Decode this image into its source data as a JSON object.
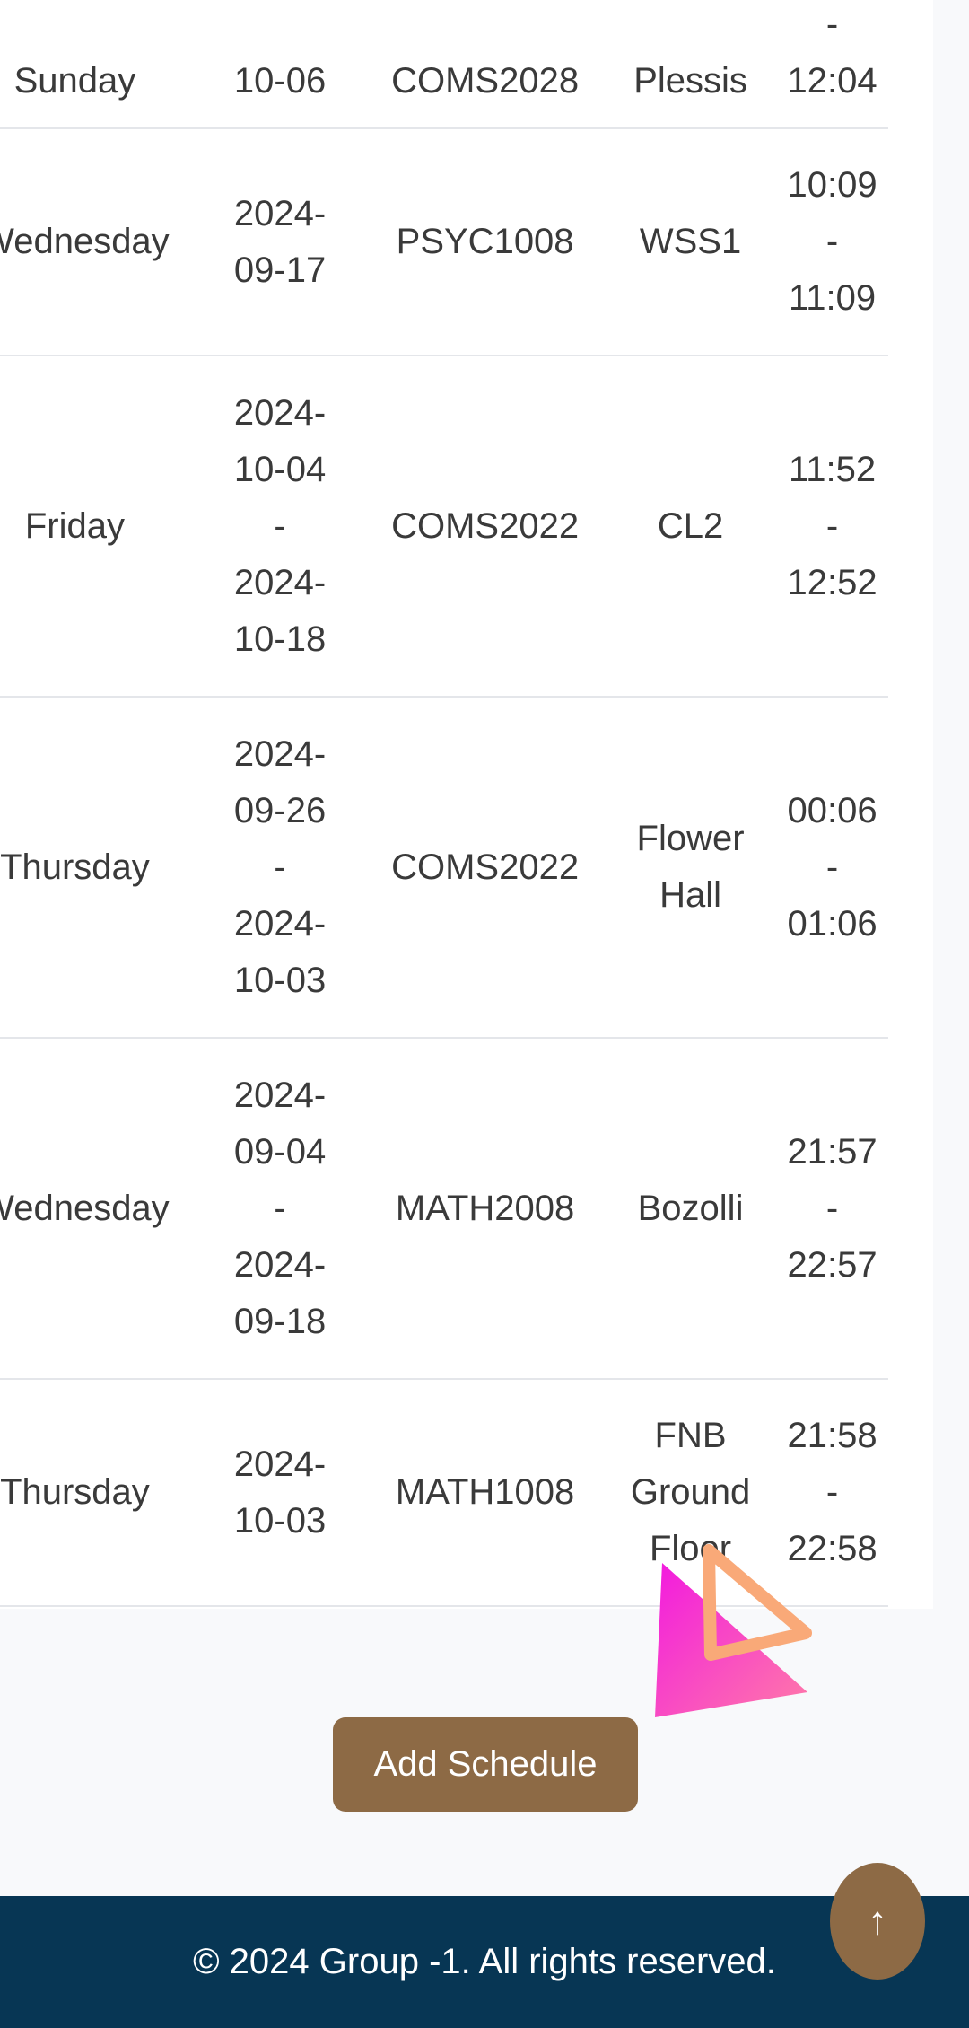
{
  "table": {
    "rows": [
      {
        "day": "Sunday",
        "date": [
          "10-06"
        ],
        "course": "COMS2028",
        "venue": [
          "Plessis"
        ],
        "time": [
          "-",
          "12:04"
        ]
      },
      {
        "day": "Wednesday",
        "date": [
          "2024-",
          "09-17"
        ],
        "course": "PSYC1008",
        "venue": [
          "WSS1"
        ],
        "time": [
          "10:09",
          "-",
          "11:09"
        ]
      },
      {
        "day": "Friday",
        "date": [
          "2024-",
          "10-04",
          "-",
          "2024-",
          "10-18"
        ],
        "course": "COMS2022",
        "venue": [
          "CL2"
        ],
        "time": [
          "11:52",
          "-",
          "12:52"
        ]
      },
      {
        "day": "Thursday",
        "date": [
          "2024-",
          "09-26",
          "-",
          "2024-",
          "10-03"
        ],
        "course": "COMS2022",
        "venue": [
          "Flower",
          "Hall"
        ],
        "time": [
          "00:06",
          "-",
          "01:06"
        ]
      },
      {
        "day": "Wednesday",
        "date": [
          "2024-",
          "09-04",
          "-",
          "2024-",
          "09-18"
        ],
        "course": "MATH2008",
        "venue": [
          "Bozolli"
        ],
        "time": [
          "21:57",
          "-",
          "22:57"
        ]
      },
      {
        "day": "Thursday",
        "date": [
          "2024-",
          "10-03"
        ],
        "course": "MATH1008",
        "venue": [
          "FNB",
          "Ground",
          "Floor"
        ],
        "time": [
          "21:58",
          "-",
          "22:58"
        ]
      }
    ]
  },
  "add_button": {
    "label": "Add Schedule"
  },
  "footer": {
    "text": "© 2024 Group -1. All rights reserved."
  },
  "scroll_top": {
    "label": "↑",
    "icon": "arrow-up-icon"
  },
  "colors": {
    "accent": "#8d6a45",
    "footer_bg": "#073654",
    "background": "#f8f9fb"
  }
}
